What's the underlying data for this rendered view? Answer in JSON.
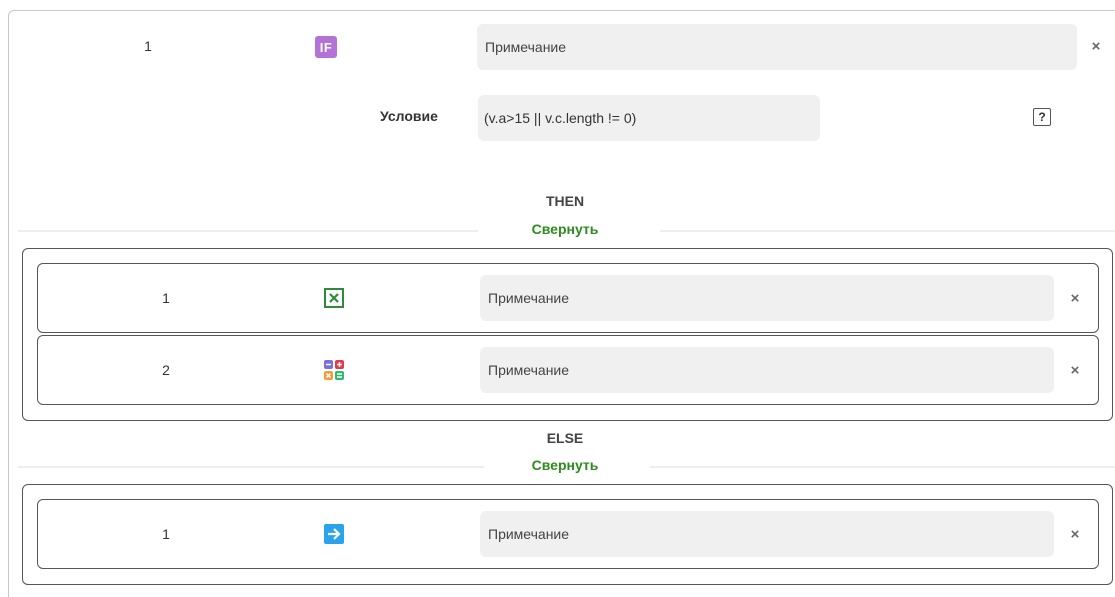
{
  "main": {
    "step_number": "1",
    "if_badge": "IF",
    "note_placeholder": "Примечание",
    "close_glyph": "×",
    "condition": {
      "label": "Условие",
      "value": "(v.a>15 || v.c.length != 0)",
      "help_glyph": "?"
    }
  },
  "then_branch": {
    "title": "THEN",
    "collapse_label": "Свернуть",
    "steps": [
      {
        "number": "1",
        "icon": "checkbox-x-icon",
        "note": "Примечание",
        "close": "×"
      },
      {
        "number": "2",
        "icon": "calculator-icon",
        "note": "Примечание",
        "close": "×"
      }
    ]
  },
  "else_branch": {
    "title": "ELSE",
    "collapse_label": "Свернуть",
    "steps": [
      {
        "number": "1",
        "icon": "arrow-right-icon",
        "note": "Примечание",
        "close": "×"
      }
    ]
  },
  "colors": {
    "if_badge": "#b572d6",
    "collapse_link": "#2e8b1f",
    "checkbox_icon": "#2e8b3a",
    "arrow_icon": "#29a3ec"
  }
}
